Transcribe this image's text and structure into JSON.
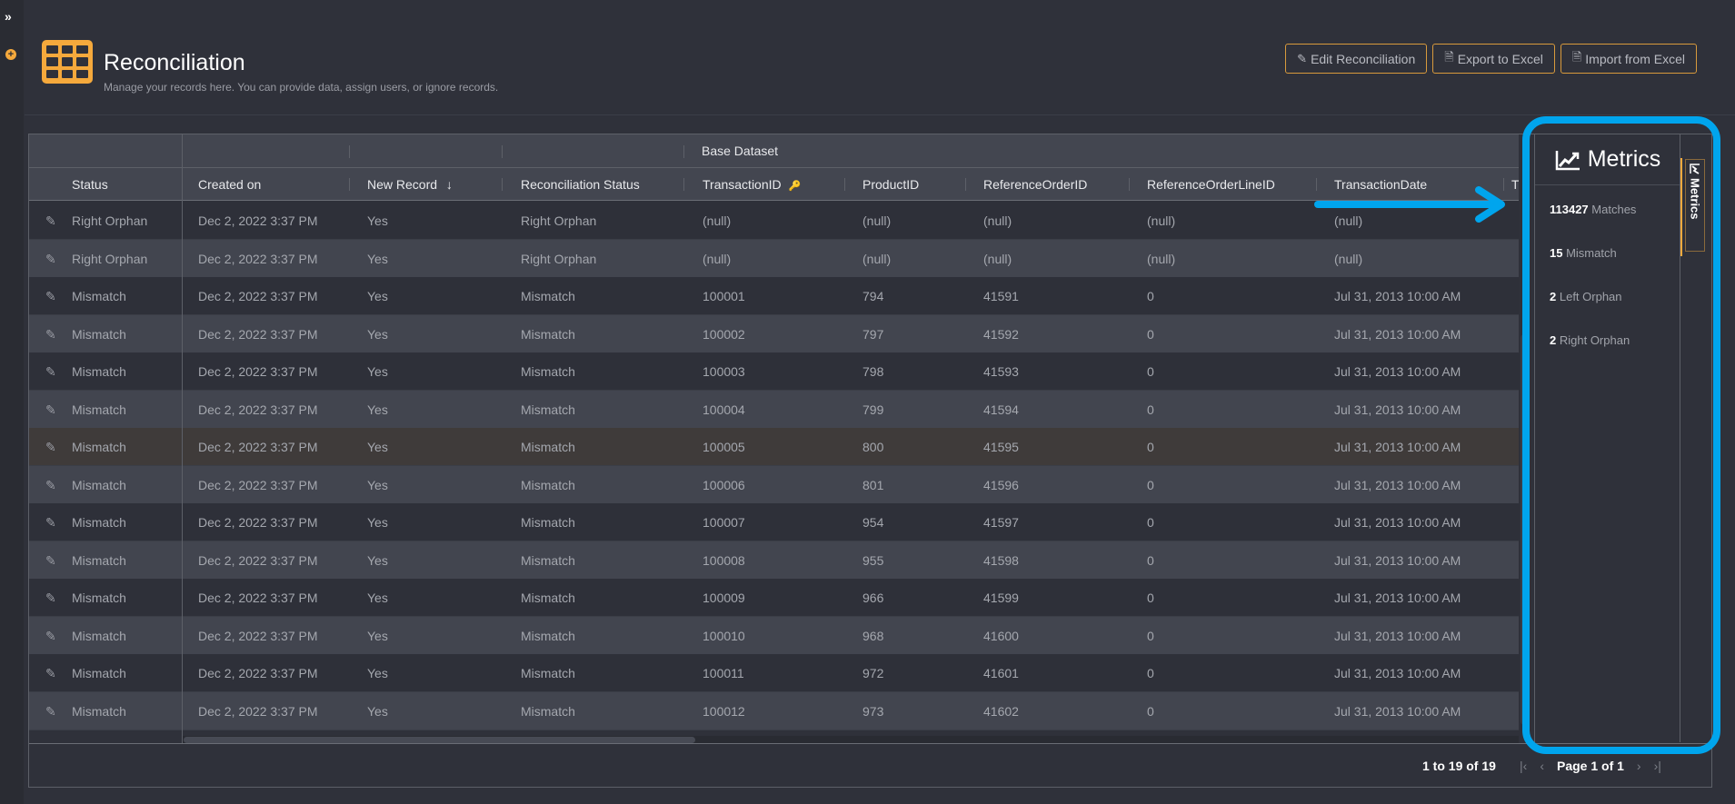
{
  "sidebar": {
    "expand_icon": "double-chevron-right-icon",
    "expand_glyph": "»",
    "add_icon": "plus-circle-icon",
    "add_glyph": "+"
  },
  "header": {
    "icon": "table-grid-icon",
    "title": "Reconciliation",
    "subtitle": "Manage your records here. You can provide data, assign users, or ignore records."
  },
  "toolbar": {
    "edit_label": "Edit Reconciliation",
    "edit_icon": "✎",
    "export_label": "Export to Excel",
    "export_icon": "🗎",
    "import_label": "Import from Excel",
    "import_icon": "🗎"
  },
  "grid": {
    "group_header": "Base Dataset",
    "columns": {
      "status": "Status",
      "created_on": "Created on",
      "new_record": "New Record",
      "new_record_sort": "↓",
      "recon_status": "Reconciliation Status",
      "transaction_id": "TransactionID",
      "transaction_id_key": "🔑",
      "product_id": "ProductID",
      "reference_order_id": "ReferenceOrderID",
      "reference_order_line_id": "ReferenceOrderLineID",
      "transaction_date": "TransactionDate",
      "partial_next": "Tra"
    },
    "edit_glyph": "✎",
    "rows": [
      {
        "status": "Right Orphan",
        "created_on": "Dec 2, 2022 3:37 PM",
        "new_record": "Yes",
        "recon_status": "Right Orphan",
        "transaction_id": "(null)",
        "product_id": "(null)",
        "reference_order_id": "(null)",
        "reference_order_line_id": "(null)",
        "transaction_date": "(null)"
      },
      {
        "status": "Right Orphan",
        "created_on": "Dec 2, 2022 3:37 PM",
        "new_record": "Yes",
        "recon_status": "Right Orphan",
        "transaction_id": "(null)",
        "product_id": "(null)",
        "reference_order_id": "(null)",
        "reference_order_line_id": "(null)",
        "transaction_date": "(null)"
      },
      {
        "status": "Mismatch",
        "created_on": "Dec 2, 2022 3:37 PM",
        "new_record": "Yes",
        "recon_status": "Mismatch",
        "transaction_id": "100001",
        "product_id": "794",
        "reference_order_id": "41591",
        "reference_order_line_id": "0",
        "transaction_date": "Jul 31, 2013 10:00 AM"
      },
      {
        "status": "Mismatch",
        "created_on": "Dec 2, 2022 3:37 PM",
        "new_record": "Yes",
        "recon_status": "Mismatch",
        "transaction_id": "100002",
        "product_id": "797",
        "reference_order_id": "41592",
        "reference_order_line_id": "0",
        "transaction_date": "Jul 31, 2013 10:00 AM"
      },
      {
        "status": "Mismatch",
        "created_on": "Dec 2, 2022 3:37 PM",
        "new_record": "Yes",
        "recon_status": "Mismatch",
        "transaction_id": "100003",
        "product_id": "798",
        "reference_order_id": "41593",
        "reference_order_line_id": "0",
        "transaction_date": "Jul 31, 2013 10:00 AM"
      },
      {
        "status": "Mismatch",
        "created_on": "Dec 2, 2022 3:37 PM",
        "new_record": "Yes",
        "recon_status": "Mismatch",
        "transaction_id": "100004",
        "product_id": "799",
        "reference_order_id": "41594",
        "reference_order_line_id": "0",
        "transaction_date": "Jul 31, 2013 10:00 AM"
      },
      {
        "status": "Mismatch",
        "created_on": "Dec 2, 2022 3:37 PM",
        "new_record": "Yes",
        "recon_status": "Mismatch",
        "transaction_id": "100005",
        "product_id": "800",
        "reference_order_id": "41595",
        "reference_order_line_id": "0",
        "transaction_date": "Jul 31, 2013 10:00 AM",
        "hovered": true
      },
      {
        "status": "Mismatch",
        "created_on": "Dec 2, 2022 3:37 PM",
        "new_record": "Yes",
        "recon_status": "Mismatch",
        "transaction_id": "100006",
        "product_id": "801",
        "reference_order_id": "41596",
        "reference_order_line_id": "0",
        "transaction_date": "Jul 31, 2013 10:00 AM"
      },
      {
        "status": "Mismatch",
        "created_on": "Dec 2, 2022 3:37 PM",
        "new_record": "Yes",
        "recon_status": "Mismatch",
        "transaction_id": "100007",
        "product_id": "954",
        "reference_order_id": "41597",
        "reference_order_line_id": "0",
        "transaction_date": "Jul 31, 2013 10:00 AM"
      },
      {
        "status": "Mismatch",
        "created_on": "Dec 2, 2022 3:37 PM",
        "new_record": "Yes",
        "recon_status": "Mismatch",
        "transaction_id": "100008",
        "product_id": "955",
        "reference_order_id": "41598",
        "reference_order_line_id": "0",
        "transaction_date": "Jul 31, 2013 10:00 AM"
      },
      {
        "status": "Mismatch",
        "created_on": "Dec 2, 2022 3:37 PM",
        "new_record": "Yes",
        "recon_status": "Mismatch",
        "transaction_id": "100009",
        "product_id": "966",
        "reference_order_id": "41599",
        "reference_order_line_id": "0",
        "transaction_date": "Jul 31, 2013 10:00 AM"
      },
      {
        "status": "Mismatch",
        "created_on": "Dec 2, 2022 3:37 PM",
        "new_record": "Yes",
        "recon_status": "Mismatch",
        "transaction_id": "100010",
        "product_id": "968",
        "reference_order_id": "41600",
        "reference_order_line_id": "0",
        "transaction_date": "Jul 31, 2013 10:00 AM"
      },
      {
        "status": "Mismatch",
        "created_on": "Dec 2, 2022 3:37 PM",
        "new_record": "Yes",
        "recon_status": "Mismatch",
        "transaction_id": "100011",
        "product_id": "972",
        "reference_order_id": "41601",
        "reference_order_line_id": "0",
        "transaction_date": "Jul 31, 2013 10:00 AM"
      },
      {
        "status": "Mismatch",
        "created_on": "Dec 2, 2022 3:37 PM",
        "new_record": "Yes",
        "recon_status": "Mismatch",
        "transaction_id": "100012",
        "product_id": "973",
        "reference_order_id": "41602",
        "reference_order_line_id": "0",
        "transaction_date": "Jul 31, 2013 10:00 AM"
      }
    ]
  },
  "footer": {
    "count_text": "1 to 19 of 19",
    "first_glyph": "|‹",
    "prev_glyph": "‹",
    "page_text": "Page 1 of 1",
    "next_glyph": "›",
    "last_glyph": "›|"
  },
  "metrics": {
    "title": "Metrics",
    "icon": "line-chart-icon",
    "items": [
      {
        "value": "113427",
        "label": "Matches"
      },
      {
        "value": "15",
        "label": "Mismatch"
      },
      {
        "value": "2",
        "label": "Left Orphan"
      },
      {
        "value": "2",
        "label": "Right Orphan"
      }
    ],
    "tab_label": "Metrics"
  },
  "colors": {
    "accent": "#f5a93c",
    "annotation": "#00a5ed",
    "background": "#2f313a"
  }
}
